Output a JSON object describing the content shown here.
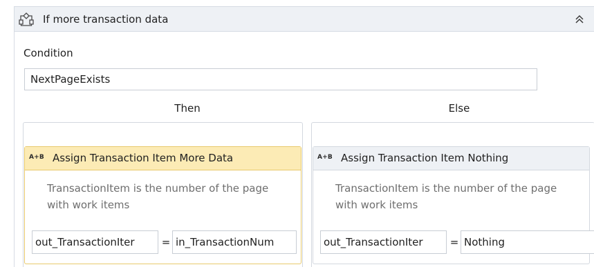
{
  "if_activity": {
    "title": "If more transaction data",
    "icon": "if-decision-icon",
    "collapse_icon": "double-chevron-up-icon",
    "condition_label": "Condition",
    "condition_value": "NextPageExists",
    "then_label": "Then",
    "else_label": "Else"
  },
  "then_branch": {
    "assign": {
      "icon_text": "A+B",
      "title": "Assign Transaction Item More Data",
      "annotation": "TransactionItem is the number of the page with work items",
      "to_value": "out_TransactionIter",
      "equals": "=",
      "value": "in_TransactionNum"
    }
  },
  "else_branch": {
    "assign": {
      "icon_text": "A+B",
      "title": "Assign Transaction Item Nothing",
      "annotation": "TransactionItem is the number of the page with work items",
      "to_value": "out_TransactionIter",
      "equals": "=",
      "value": "Nothing"
    }
  },
  "colors": {
    "header_bg": "#eef1f5",
    "selected_header_bg": "#fcebb5",
    "selected_border": "#e8c96b",
    "border": "#d6dbe3",
    "annotation_text": "#6e6e6e"
  }
}
